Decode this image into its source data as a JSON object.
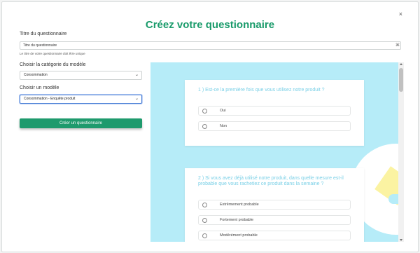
{
  "modal": {
    "close_label": "×",
    "title": "Créez votre questionnaire"
  },
  "form": {
    "title_label": "Titre du questionnaire",
    "title_placeholder": "Titre du questionnaire",
    "title_hint": "Le titre de votre questionnaire doit être unique",
    "title_field_icon": "⌘",
    "category_label": "Choisir la catégorie du modèle",
    "category_value": "Consommation",
    "model_label": "Choisir un modèle",
    "model_value": "Consommation - Enquête produit",
    "create_button_label": "Créer un questionnaire"
  },
  "preview": {
    "questions": [
      {
        "text": "1 ) Est-ce la première fois que vous utilisez notre produit ?",
        "options": [
          "Oui",
          "Non"
        ]
      },
      {
        "text": "2 ) Si vous avez déjà utilisé notre produit, dans quelle mesure est-il probable que vous rachetiez ce produit dans la semaine ?",
        "options": [
          "Extrêmement probable",
          "Fortement probable",
          "Modérément probable"
        ]
      }
    ]
  },
  "colors": {
    "accent": "#1a9b6b",
    "preview_background": "#b6ecf8",
    "question_text": "#78cfe6"
  }
}
